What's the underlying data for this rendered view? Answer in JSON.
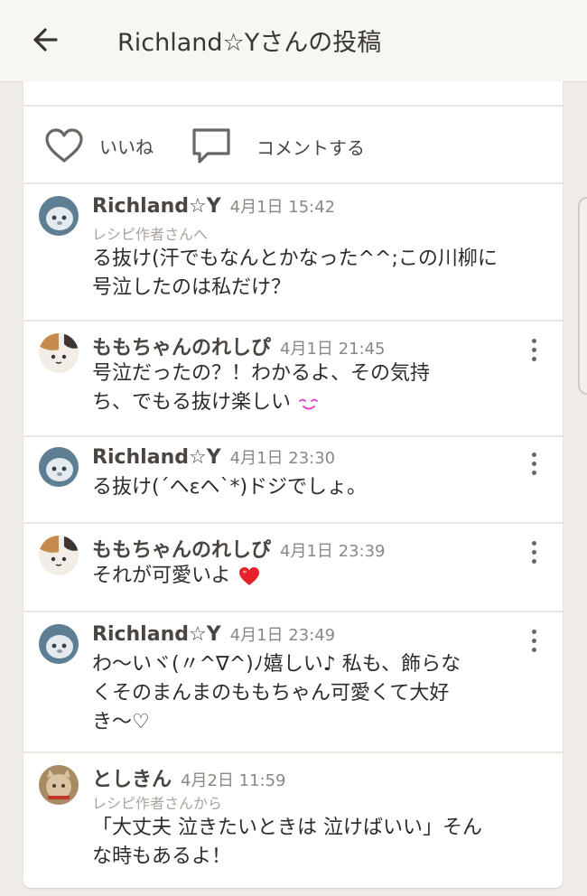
{
  "appbar": {
    "title": "Richland☆Yさんの投稿",
    "back_icon": "arrow-left-icon"
  },
  "actions": {
    "like": {
      "label": "いいね",
      "icon": "heart-outline-icon"
    },
    "comment": {
      "label": "コメントする",
      "icon": "speech-bubble-icon"
    }
  },
  "comments": [
    {
      "user": "Richland☆Y",
      "time": "4月1日 15:42",
      "sub": "レシピ作者さんへ",
      "lines": [
        "る抜け(汗でもなんとかなった^^;この川柳に",
        "号泣したのは私だけ？"
      ],
      "menu": false
    },
    {
      "user": "ももちゃんのれしぴ",
      "time": "4月1日 21:45",
      "lines": [
        "号泣だったの？！わかるよ、その気持",
        "ち、でもる抜け楽しい"
      ],
      "emoji": "smile-emoji",
      "menu": true
    },
    {
      "user": "Richland☆Y",
      "time": "4月1日 23:30",
      "lines": [
        "る抜け(´ヘεヘ`*)ドジでしょ。"
      ],
      "menu": true
    },
    {
      "user": "ももちゃんのれしぴ",
      "time": "4月1日 23:39",
      "lines": [
        "それが可愛いよ"
      ],
      "emoji": "red-heart-emoji",
      "menu": true
    },
    {
      "user": "Richland☆Y",
      "time": "4月1日 23:49",
      "lines": [
        "わ〜いヾ(〃^∇^)ﾉ嬉しい♪ 私も、飾らな",
        "くそのまんまのももちゃん可愛くて大好",
        "き〜♡"
      ],
      "menu": true
    },
    {
      "user": "としきん",
      "time": "4月2日 11:59",
      "sub": "レシピ作者さんから",
      "lines": [
        "「大丈夫 泣きたいときは 泣けばいい」そん",
        "な時もあるよ！"
      ],
      "menu": false
    }
  ],
  "colors": {
    "background": "#efebe6",
    "card": "#ffffff",
    "heart_emoji": "#e8202a",
    "smile_emoji": "#e040c8"
  }
}
